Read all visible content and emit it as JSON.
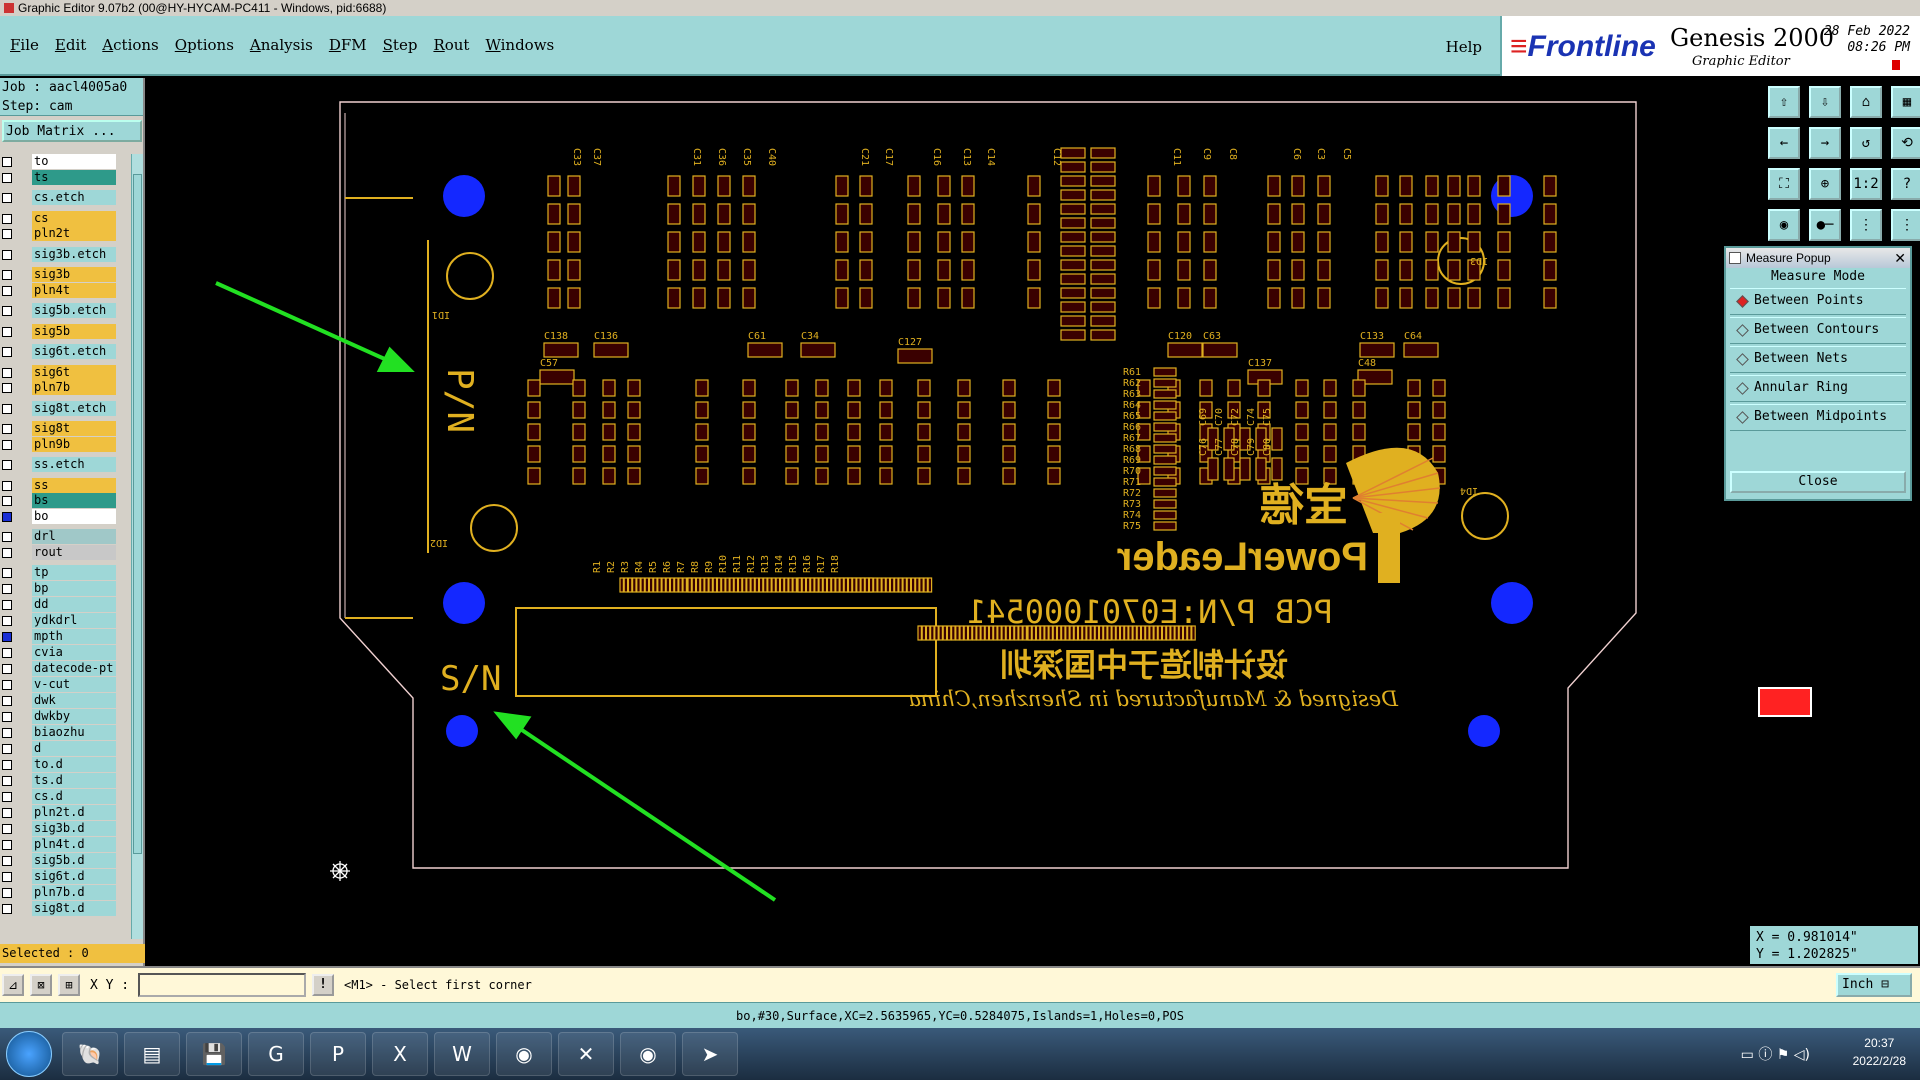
{
  "window": {
    "title": "Graphic Editor 9.07b2 (00@HY-HYCAM-PC411 - Windows, pid:6688)"
  },
  "menu": {
    "items": [
      "File",
      "Edit",
      "Actions",
      "Options",
      "Analysis",
      "DFM",
      "Step",
      "Rout",
      "Windows"
    ],
    "help": "Help"
  },
  "brand": {
    "logo": "Frontline",
    "product": "Genesis 2000",
    "subtitle": "Graphic Editor",
    "date": "28 Feb 2022",
    "time": "08:26 PM"
  },
  "job": {
    "job_line": "Job : aacl4005a0",
    "step_line": "Step: cam",
    "matrix_button": "Job Matrix ..."
  },
  "layers": [
    {
      "name": "to",
      "color": "#ffffff",
      "on": false
    },
    {
      "name": "ts",
      "color": "#2e9a8a",
      "on": false
    },
    {
      "name": "cs.etch",
      "color": "#9ed7d7",
      "on": false
    },
    {
      "name": "cs",
      "color": "#f0c040",
      "on": false
    },
    {
      "name": "pln2t",
      "color": "#f0c040",
      "on": false
    },
    {
      "name": "sig3b.etch",
      "color": "#9ed7d7",
      "on": false
    },
    {
      "name": "sig3b",
      "color": "#f0c040",
      "on": false
    },
    {
      "name": "pln4t",
      "color": "#f0c040",
      "on": false
    },
    {
      "name": "sig5b.etch",
      "color": "#9ed7d7",
      "on": false
    },
    {
      "name": "sig5b",
      "color": "#f0c040",
      "on": false
    },
    {
      "name": "sig6t.etch",
      "color": "#9ed7d7",
      "on": false
    },
    {
      "name": "sig6t",
      "color": "#f0c040",
      "on": false
    },
    {
      "name": "pln7b",
      "color": "#f0c040",
      "on": false
    },
    {
      "name": "sig8t.etch",
      "color": "#9ed7d7",
      "on": false
    },
    {
      "name": "sig8t",
      "color": "#f0c040",
      "on": false
    },
    {
      "name": "pln9b",
      "color": "#f0c040",
      "on": false
    },
    {
      "name": "ss.etch",
      "color": "#9ed7d7",
      "on": false
    },
    {
      "name": "ss",
      "color": "#f0c040",
      "on": false
    },
    {
      "name": "bs",
      "color": "#2e9a8a",
      "on": false
    },
    {
      "name": "bo",
      "color": "#ffffff",
      "on": true
    },
    {
      "name": "drl",
      "color": "#a0c8c8",
      "on": false
    },
    {
      "name": "rout",
      "color": "#c8c8c8",
      "on": false
    },
    {
      "name": "tp",
      "color": "#9ed7d7",
      "on": false
    },
    {
      "name": "bp",
      "color": "#9ed7d7",
      "on": false
    },
    {
      "name": "dd",
      "color": "#9ed7d7",
      "on": false
    },
    {
      "name": "ydkdrl",
      "color": "#9ed7d7",
      "on": false
    },
    {
      "name": "mpth",
      "color": "#9ed7d7",
      "on": true
    },
    {
      "name": "cvia",
      "color": "#9ed7d7",
      "on": false
    },
    {
      "name": "datecode-pt",
      "color": "#9ed7d7",
      "on": false
    },
    {
      "name": "v-cut",
      "color": "#9ed7d7",
      "on": false
    },
    {
      "name": "dwk",
      "color": "#9ed7d7",
      "on": false
    },
    {
      "name": "dwkby",
      "color": "#9ed7d7",
      "on": false
    },
    {
      "name": "biaozhu",
      "color": "#9ed7d7",
      "on": false
    },
    {
      "name": "d",
      "color": "#9ed7d7",
      "on": false
    },
    {
      "name": "to.d",
      "color": "#9ed7d7",
      "on": false
    },
    {
      "name": "ts.d",
      "color": "#9ed7d7",
      "on": false
    },
    {
      "name": "cs.d",
      "color": "#9ed7d7",
      "on": false
    },
    {
      "name": "pln2t.d",
      "color": "#9ed7d7",
      "on": false
    },
    {
      "name": "sig3b.d",
      "color": "#9ed7d7",
      "on": false
    },
    {
      "name": "pln4t.d",
      "color": "#9ed7d7",
      "on": false
    },
    {
      "name": "sig5b.d",
      "color": "#9ed7d7",
      "on": false
    },
    {
      "name": "sig6t.d",
      "color": "#9ed7d7",
      "on": false
    },
    {
      "name": "pln7b.d",
      "color": "#9ed7d7",
      "on": false
    },
    {
      "name": "sig8t.d",
      "color": "#9ed7d7",
      "on": false
    }
  ],
  "selected": "Selected : 0",
  "canvas": {
    "label_pn": "P/N",
    "label_sn": "S/N",
    "label_pcb_pn": "PCB P/N:E0701000541",
    "label_brand": "PowerLeader",
    "label_chinese": "设计制造于中国深圳",
    "label_designed": "Designed & Manufactured in Shenzhen,China",
    "label_chinese_brand": "宝德",
    "refdes": {
      "top_row": [
        "C33",
        "C37",
        "C31",
        "C36",
        "C35",
        "C40",
        "C21",
        "C17",
        "C16",
        "C13",
        "C14",
        "C12",
        "C11",
        "C9",
        "C8",
        "C6",
        "C3",
        "C5"
      ],
      "right_small": [
        "C69",
        "C70",
        "C72",
        "C74",
        "C75",
        "C76",
        "C77",
        "C78",
        "C79",
        "C80"
      ],
      "mid_row": [
        "C138",
        "C136",
        "C57",
        "C61",
        "C34",
        "C127",
        "C120",
        "C63",
        "C133",
        "C64",
        "C137",
        "C48"
      ],
      "resistors": [
        "R61",
        "R62",
        "R63",
        "R64",
        "R65",
        "R66",
        "R67",
        "R68",
        "R69",
        "R70",
        "R71",
        "R72",
        "R73",
        "R74",
        "R75"
      ],
      "connector": [
        "R1",
        "R2",
        "R3",
        "R4",
        "R5",
        "R6",
        "R7",
        "R8",
        "R9",
        "R10",
        "R11",
        "R12",
        "R13",
        "R14",
        "R15",
        "R16",
        "R17",
        "R18"
      ],
      "ids": [
        "ID1",
        "ID2",
        "ID3",
        "ID4"
      ]
    }
  },
  "measure": {
    "title": "Measure Popup",
    "mode_label": "Measure Mode",
    "options": [
      "Between Points",
      "Between Contours",
      "Between Nets",
      "Annular Ring",
      "Between Midpoints"
    ],
    "selected_index": 0,
    "close_label": "Close"
  },
  "toolbox": {
    "icons": [
      "zoom-home-icon",
      "zoom-in-icon",
      "home-icon",
      "grid-icon",
      "pan-left-icon",
      "pan-right-icon",
      "redraw-icon",
      "snap-icon",
      "fit-icon",
      "center-icon",
      "one-to-one-icon",
      "help-icon",
      "eye-icon",
      "measure-ruler-icon",
      "net-icon",
      "net-alt-icon"
    ],
    "labels": [
      "⇧",
      "⇩",
      "⌂",
      "▦",
      "←",
      "→",
      "↺",
      "⟲",
      "⛶",
      "⊕",
      "1:2",
      "?",
      "◉",
      "●─",
      "⋮",
      "⋮"
    ]
  },
  "coords": {
    "x": "X = 0.981014\"",
    "y": "Y = 1.202825\""
  },
  "command": {
    "xy_label": "X Y :",
    "xy_value": "",
    "warn_label": "!",
    "prompt": "<M1> - Select first corner",
    "units": "Inch ⊟"
  },
  "status": "bo,#30,Surface,XC=2.5635965,YC=0.5284075,Islands=1,Holes=0,POS",
  "taskbar": {
    "apps": [
      "shell-icon",
      "notepad-icon",
      "save-icon",
      "genesis-icon",
      "pads-icon",
      "excel-icon",
      "word-icon",
      "eye-app-icon",
      "x-app-icon",
      "eye2-app-icon",
      "send-icon"
    ],
    "labels": [
      "🐚",
      "▤",
      "💾",
      "G",
      "P",
      "X",
      "W",
      "◉",
      "✕",
      "◉",
      "➤"
    ],
    "clock_time": "20:37",
    "clock_date": "2022/2/28"
  }
}
